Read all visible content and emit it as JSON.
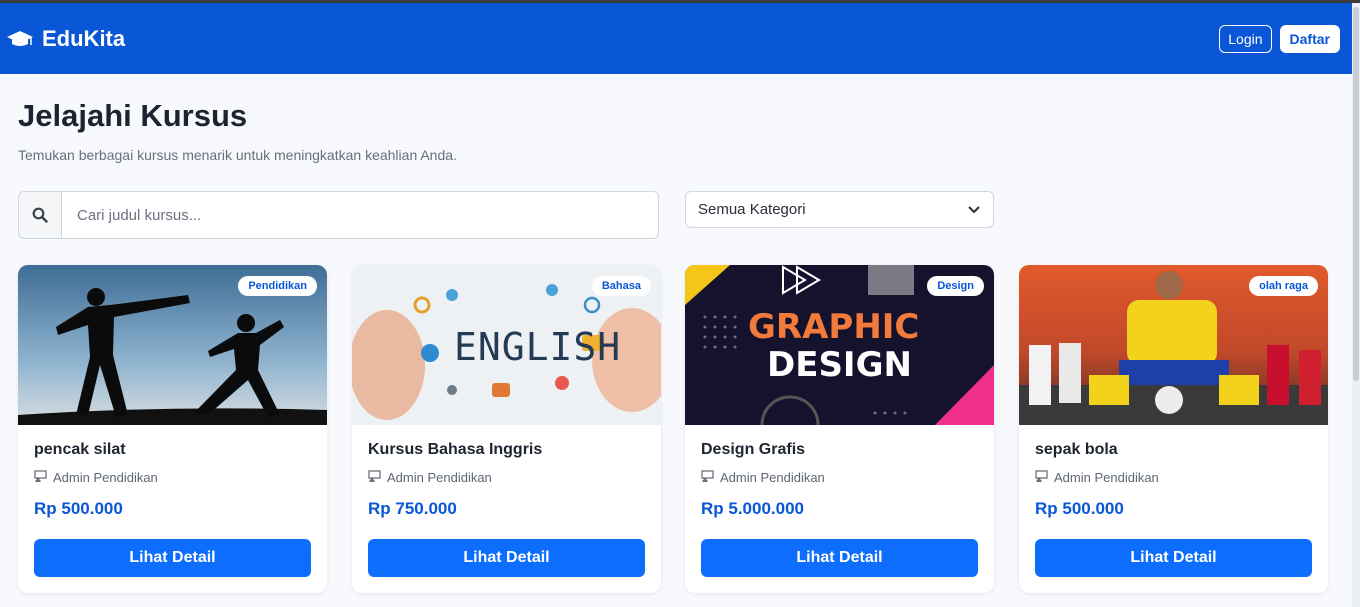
{
  "navbar": {
    "brand": "EduKita",
    "brand_icon": "graduation-cap-icon",
    "login_label": "Login",
    "register_label": "Daftar",
    "color": "#0957d6"
  },
  "main": {
    "title": "Jelajahi Kursus",
    "subtitle": "Temukan berbagai kursus menarik untuk meningkatkan keahlian Anda.",
    "search": {
      "placeholder": "Cari judul kursus...",
      "value": ""
    },
    "category_select": {
      "selected": "Semua Kategori"
    }
  },
  "courses": [
    {
      "title": "pencak silat",
      "category": "Pendidikan",
      "author": "Admin Pendidikan",
      "price": "Rp 500.000",
      "button": "Lihat Detail"
    },
    {
      "title": "Kursus Bahasa Inggris",
      "category": "Bahasa",
      "author": "Admin Pendidikan",
      "price": "Rp 750.000",
      "button": "Lihat Detail"
    },
    {
      "title": "Design Grafis",
      "category": "Design",
      "author": "Admin Pendidikan",
      "price": "Rp 5.000.000",
      "button": "Lihat Detail"
    },
    {
      "title": "sepak bola",
      "category": "olah raga",
      "author": "Admin Pendidikan",
      "price": "Rp 500.000",
      "button": "Lihat Detail"
    }
  ],
  "images": {
    "english_text": "ENGLISH",
    "graphic_line1": "GRAPHIC",
    "graphic_line2": "DESIGN"
  }
}
